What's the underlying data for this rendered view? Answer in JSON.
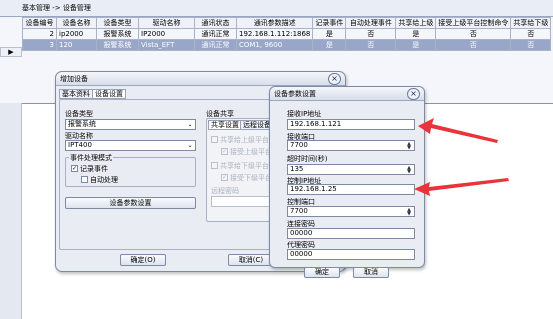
{
  "breadcrumb": "基本管理 -> 设备管理",
  "table": {
    "columns": [
      "设备编号",
      "设备名称",
      "设备类型",
      "驱动名称",
      "通讯状态",
      "通讯参数描述",
      "记录事件",
      "自动处理事件",
      "共享给上级",
      "接受上级平台控制命令",
      "共享给下级"
    ],
    "rows": [
      {
        "no": "2",
        "name": "ip2000",
        "type": "报警系统",
        "driver": "IP2000",
        "status": "通讯正常",
        "params": "192.168.1.112:1868",
        "record": "是",
        "auto": "否",
        "share_up": "是",
        "accept_ctrl": "否",
        "share_down": "否"
      },
      {
        "no": "3",
        "name": "120",
        "type": "报警系统",
        "driver": "Vista_EFT",
        "status": "通讯正常",
        "params": "COM1, 9600",
        "record": "是",
        "auto": "否",
        "share_up": "是",
        "accept_ctrl": "否",
        "share_down": "否"
      }
    ],
    "selected_row_index": 1,
    "row_pointer": "▶"
  },
  "add_dialog": {
    "title": "增加设备",
    "tabs": [
      "基本资料",
      "设备设置"
    ],
    "active_tab_index": 1,
    "device_type_label": "设备类型",
    "device_type_value": "报警系统",
    "driver_label": "驱动名称",
    "driver_value": "IPT400",
    "event_mode_label": "事件处理模式",
    "record_event_label": "记录事件",
    "record_event_checked": true,
    "auto_process_label": "自动处理",
    "auto_process_checked": false,
    "param_settings_button": "设备参数设置",
    "share_group_label": "设备共享",
    "share_tabs": [
      "共享设置",
      "远程设备"
    ],
    "share_up_label": "共享给上级平台",
    "accept_up_label": "接受上级平台控制",
    "share_down_label": "共享给下级平台",
    "accept_down_label": "接受下级平台控制",
    "remote_label": "远程密码",
    "ok_button": "确定(O)",
    "cancel_button": "取消(C)"
  },
  "param_dialog": {
    "title": "设备参数设置",
    "recv_ip_label": "接收IP地址",
    "recv_ip_value": "192.168.1.121",
    "recv_port_label": "接收端口",
    "recv_port_value": "7700",
    "timeout_label": "超时时间(秒)",
    "timeout_value": "135",
    "ctrl_ip_label": "控制IP地址",
    "ctrl_ip_value": "192.168.1.25",
    "ctrl_port_label": "控制端口",
    "ctrl_port_value": "7700",
    "conn_pwd_label": "连接密码",
    "conn_pwd_value": "00000",
    "proxy_pwd_label": "代理密码",
    "proxy_pwd_value": "00000",
    "ok_button": "确定",
    "cancel_button": "取消"
  },
  "colors": {
    "arrow": "#e8343a",
    "selected_row": "#98a6c8"
  }
}
